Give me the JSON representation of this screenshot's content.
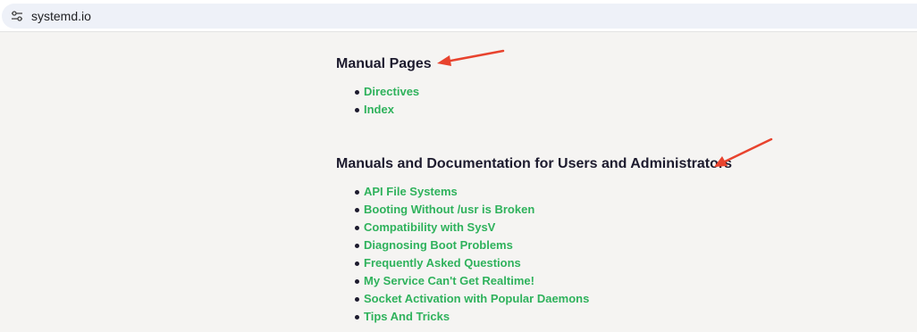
{
  "browser": {
    "url": "systemd.io",
    "site_icon": "tune-icon"
  },
  "sections": [
    {
      "title": "Manual Pages",
      "links": [
        "Directives",
        "Index"
      ]
    },
    {
      "title": "Manuals and Documentation for Users and Administrators",
      "links": [
        "API File Systems",
        "Booting Without /usr is Broken",
        "Compatibility with SysV",
        "Diagnosing Boot Problems",
        "Frequently Asked Questions",
        "My Service Can't Get Realtime!",
        "Socket Activation with Popular Daemons",
        "Tips And Tricks"
      ]
    }
  ],
  "colors": {
    "link": "#2fb25c",
    "heading": "#1d1b2e",
    "background": "#f5f4f2",
    "annotation_arrow": "#e8432e"
  }
}
